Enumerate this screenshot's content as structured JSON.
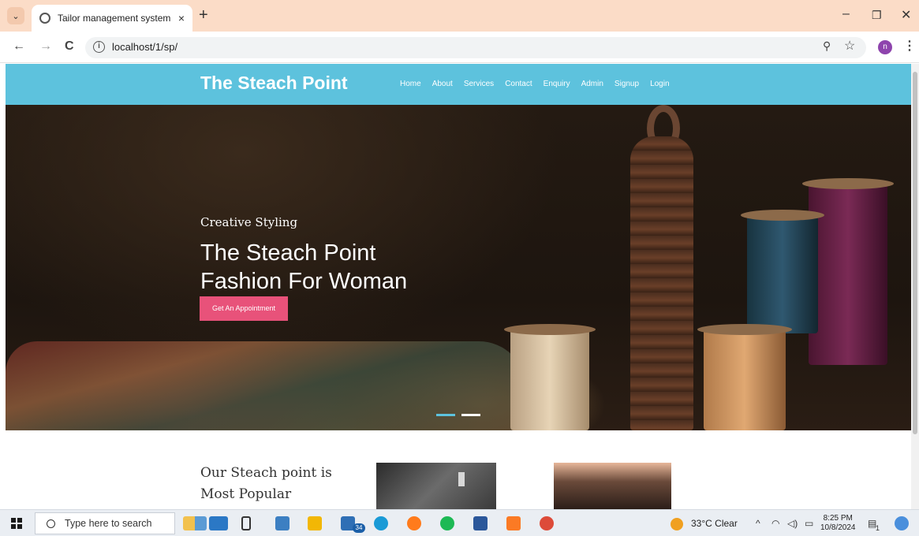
{
  "browser": {
    "tab_title": "Tailor management system",
    "tab_close": "×",
    "new_tab": "+",
    "url": "localhost/1/sp/",
    "profile_initial": "n",
    "info_glyph": "i",
    "icons": [
      "tab-search-icon",
      "site-favicon",
      "back-arrow-icon",
      "forward-arrow-icon",
      "reload-icon",
      "site-info-icon",
      "zoom-icon",
      "bookmark-star-icon",
      "kebab-menu-icon"
    ]
  },
  "site": {
    "brand": "The Steach Point",
    "nav": [
      "Home",
      "About",
      "Services",
      "Contact",
      "Enquiry",
      "Admin",
      "Signup",
      "Login"
    ],
    "header_color": "#5dc2dd",
    "hero": {
      "subtitle": "Creative Styling",
      "title_line1": "The Steach Point",
      "title_line2": "Fashion For Woman",
      "cta": "Get An Appointment",
      "cta_color": "#e8527a",
      "slides": 2
    },
    "section": {
      "line1": "Our Steach point is",
      "line2": "Most Popular"
    }
  },
  "taskbar": {
    "search_placeholder": "Type here to search",
    "mail_badge": "34",
    "weather": "33°C  Clear",
    "time": "8:25 PM",
    "date": "10/8/2024",
    "notification_count": "1",
    "apps": [
      "start-icon",
      "widgets-icon",
      "task-view-icon",
      "store-icon",
      "file-explorer-icon",
      "mail-icon",
      "edge-icon",
      "firefox-icon",
      "spotify-icon",
      "word-icon",
      "xampp-icon",
      "chrome-icon"
    ]
  }
}
